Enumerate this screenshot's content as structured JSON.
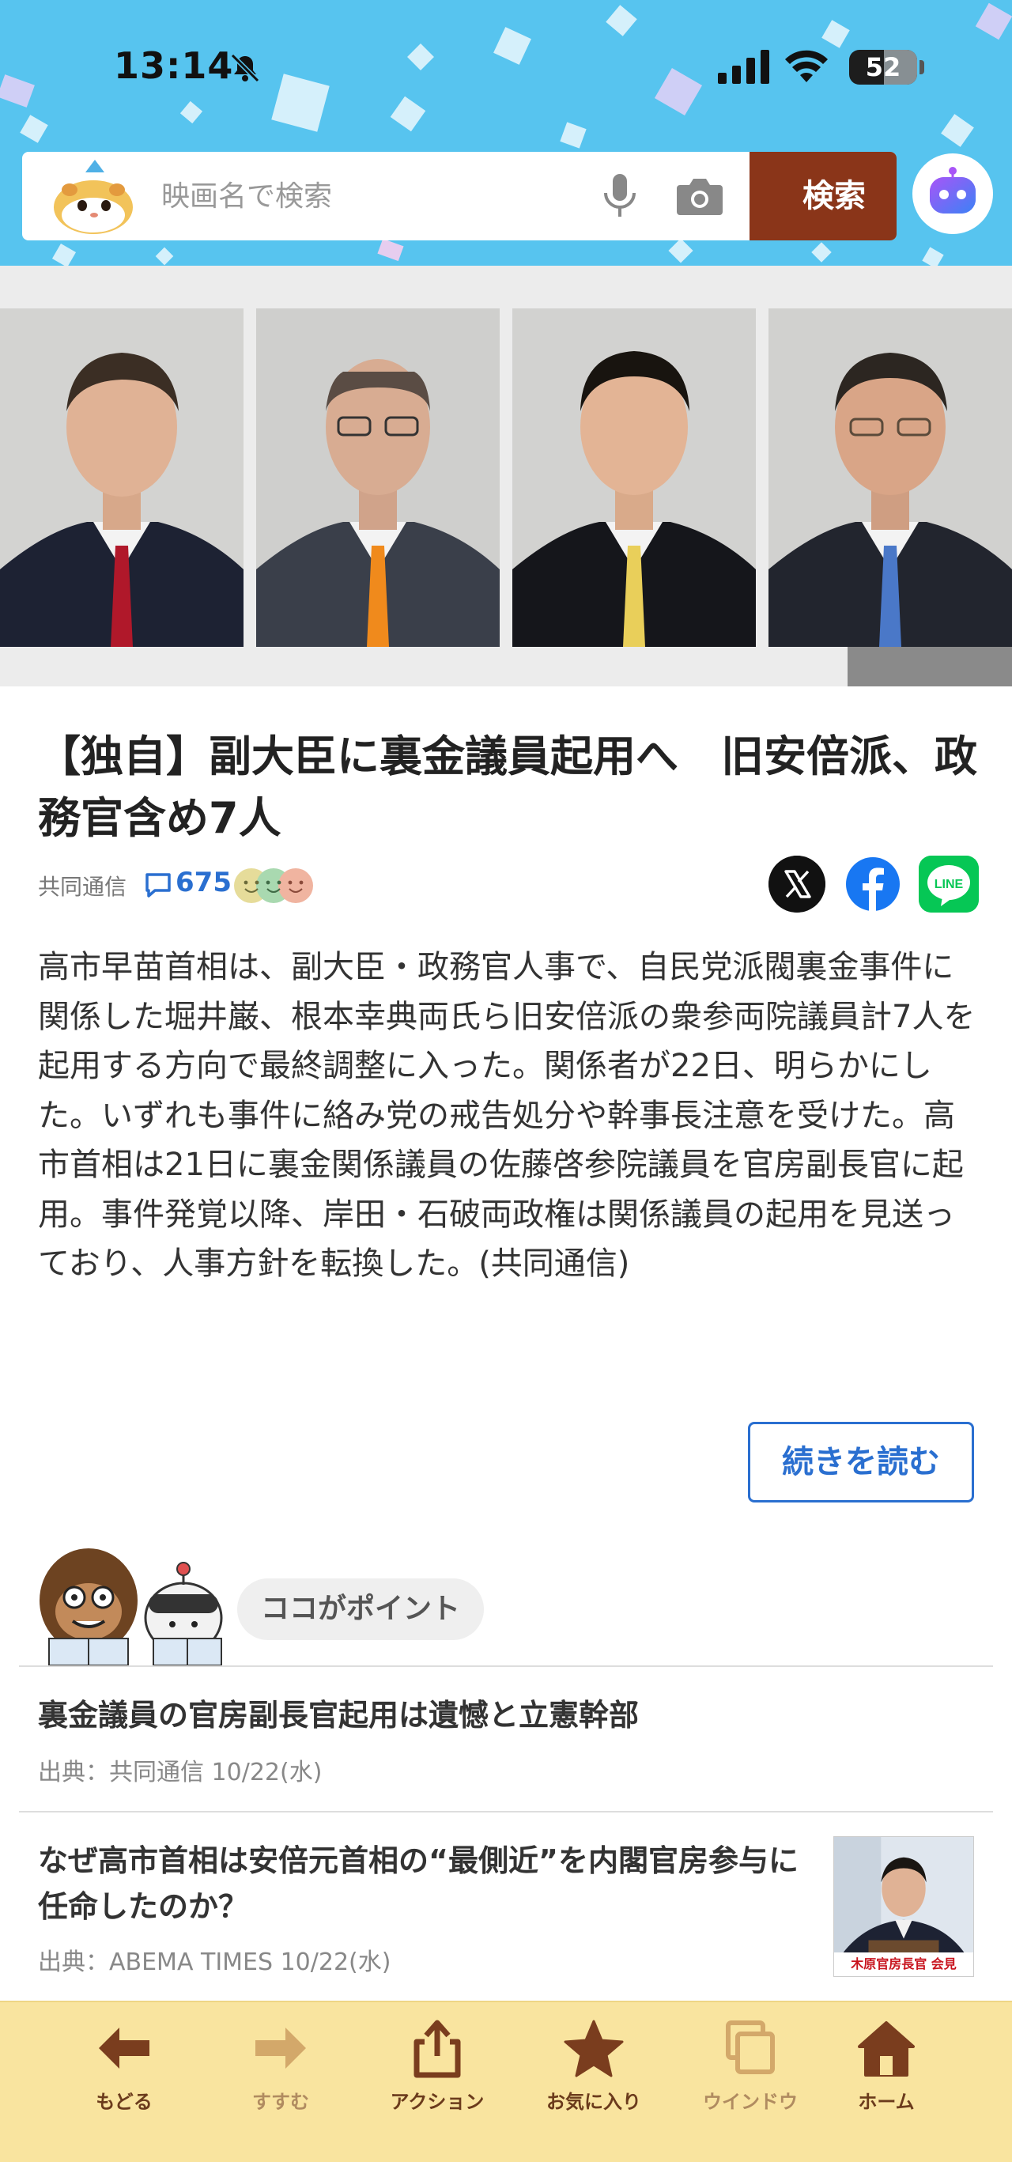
{
  "status_bar": {
    "time": "13:14",
    "battery": "52"
  },
  "search": {
    "placeholder": "映画名で検索",
    "button_label": "検索"
  },
  "article": {
    "title": "【独自】副大臣に裏金議員起用へ　旧安倍派、政務官含め7人",
    "source": "共同通信",
    "comment_count": "675",
    "body": "高市早苗首相は、副大臣・政務官人事で、自民党派閥裏金事件に関係した堀井巌、根本幸典両氏ら旧安倍派の衆参両院議員計7人を起用する方向で最終調整に入った。関係者が22日、明らかにした。いずれも事件に絡み党の戒告処分や幹事長注意を受けた。高市首相は21日に裏金関係議員の佐藤啓参院議員を官房副長官に起用。事件発覚以降、岸田・石破両政権は関係議員の起用を見送っており、人事方針を転換した。(共同通信)",
    "read_more_label": "続きを読む"
  },
  "point": {
    "label": "ココがポイント",
    "items": [
      {
        "title": "裏金議員の官房副長官起用は遺憾と立憲幹部",
        "source": "出典：共同通信 10/22(水)"
      },
      {
        "title": "なぜ高市首相は安倍元首相の“最側近”を内閣官房参与に任命したのか？",
        "source": "出典：ABEMA TIMES 10/22(水)",
        "thumb_caption": "木原官房長官 会見"
      }
    ]
  },
  "toolbar": {
    "items": [
      {
        "label": "もどる",
        "icon": "back-arrow-icon",
        "enabled": true
      },
      {
        "label": "すすむ",
        "icon": "forward-arrow-icon",
        "enabled": false
      },
      {
        "label": "アクション",
        "icon": "share-icon",
        "enabled": true
      },
      {
        "label": "お気に入り",
        "icon": "star-icon",
        "enabled": true
      },
      {
        "label": "ウインドウ",
        "icon": "windows-icon",
        "enabled": false
      },
      {
        "label": "ホーム",
        "icon": "home-icon",
        "enabled": true
      }
    ]
  },
  "colors": {
    "header_bg": "#57c4ef",
    "search_button": "#8a3519",
    "link_blue": "#2a6fd0",
    "toolbar_bg": "#f9e49f",
    "toolbar_icon": "#7a3d1e"
  }
}
